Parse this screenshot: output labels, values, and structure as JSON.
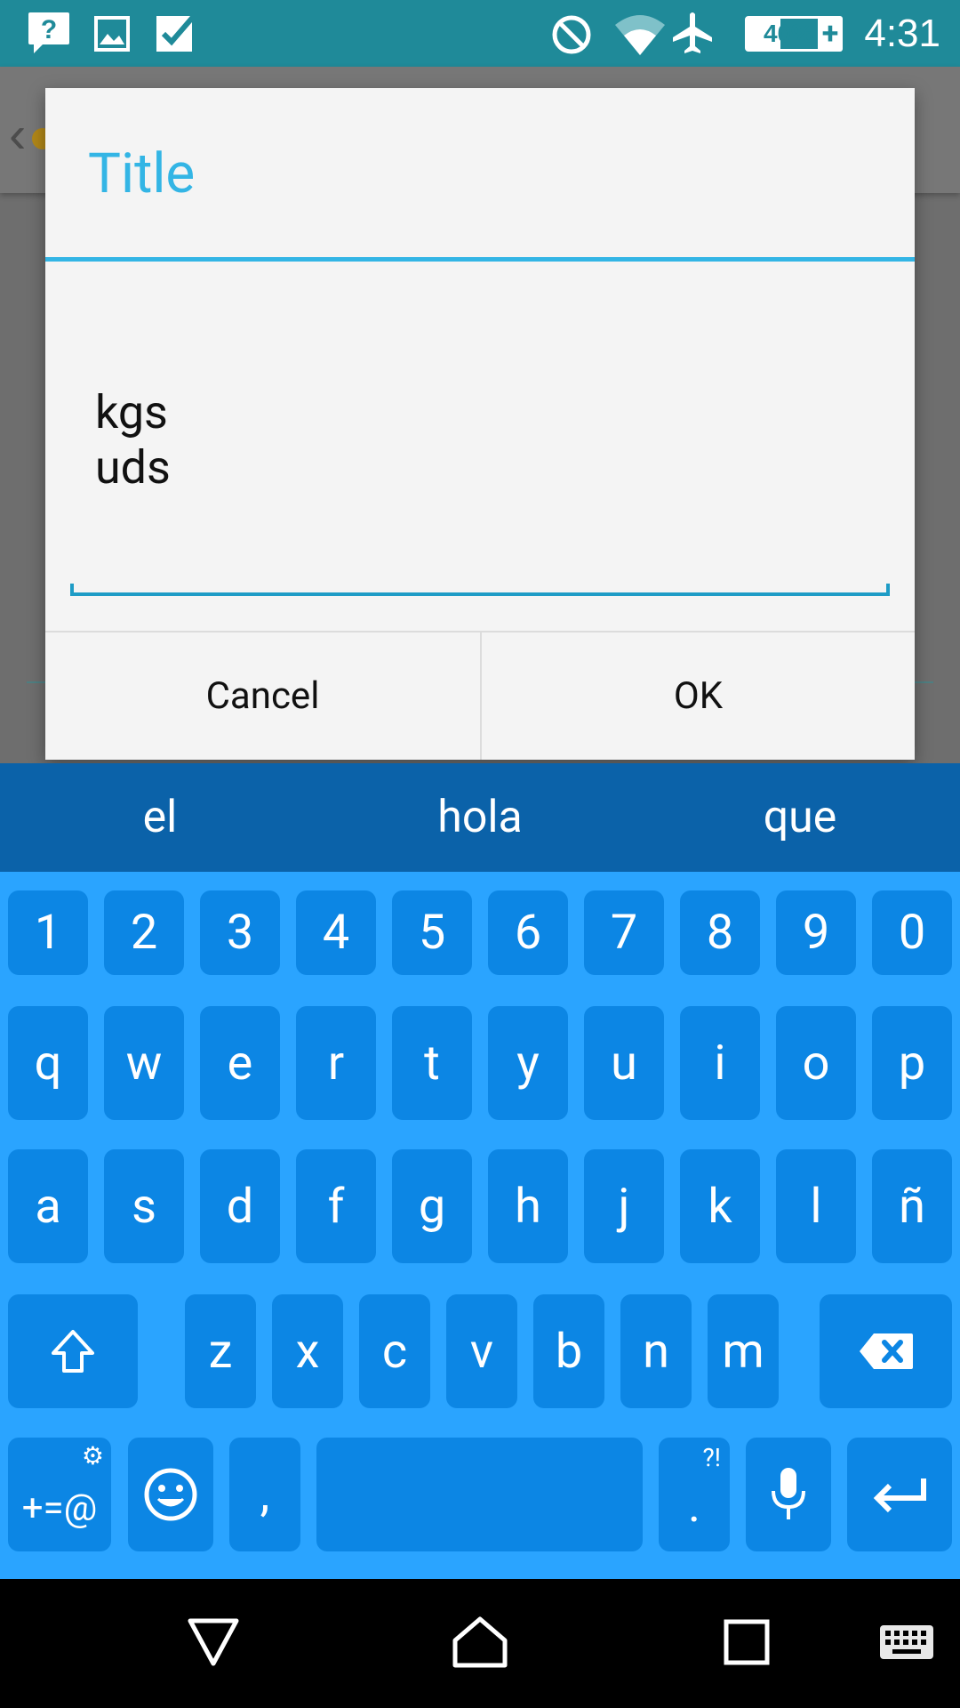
{
  "status_bar": {
    "time": "4:31",
    "battery_percent": "40%",
    "battery_plus": "+",
    "icons": [
      "help-chat-icon",
      "image-icon",
      "check-icon",
      "do-not-disturb-icon",
      "wifi-icon",
      "airplane-icon",
      "battery-icon"
    ]
  },
  "dialog": {
    "title": "Title",
    "text_lines": [
      "kgs",
      "uds"
    ],
    "cancel_label": "Cancel",
    "ok_label": "OK"
  },
  "keyboard": {
    "suggestions": [
      "el",
      "hola",
      "que"
    ],
    "row_numbers": [
      "1",
      "2",
      "3",
      "4",
      "5",
      "6",
      "7",
      "8",
      "9",
      "0"
    ],
    "row1": [
      "q",
      "w",
      "e",
      "r",
      "t",
      "y",
      "u",
      "i",
      "o",
      "p"
    ],
    "row2": [
      "a",
      "s",
      "d",
      "f",
      "g",
      "h",
      "j",
      "k",
      "l",
      "ñ"
    ],
    "row3": [
      "z",
      "x",
      "c",
      "v",
      "b",
      "n",
      "m"
    ],
    "symbols_label": "+=@",
    "comma_label": ",",
    "period_label": ".",
    "period_alt": "?!",
    "colors": {
      "background": "#2aa4ff",
      "key": "#0c86e4",
      "suggest_bar": "#0b62a9"
    }
  },
  "colors": {
    "accent": "#33b5e5",
    "status_bar": "#1f8a99"
  }
}
